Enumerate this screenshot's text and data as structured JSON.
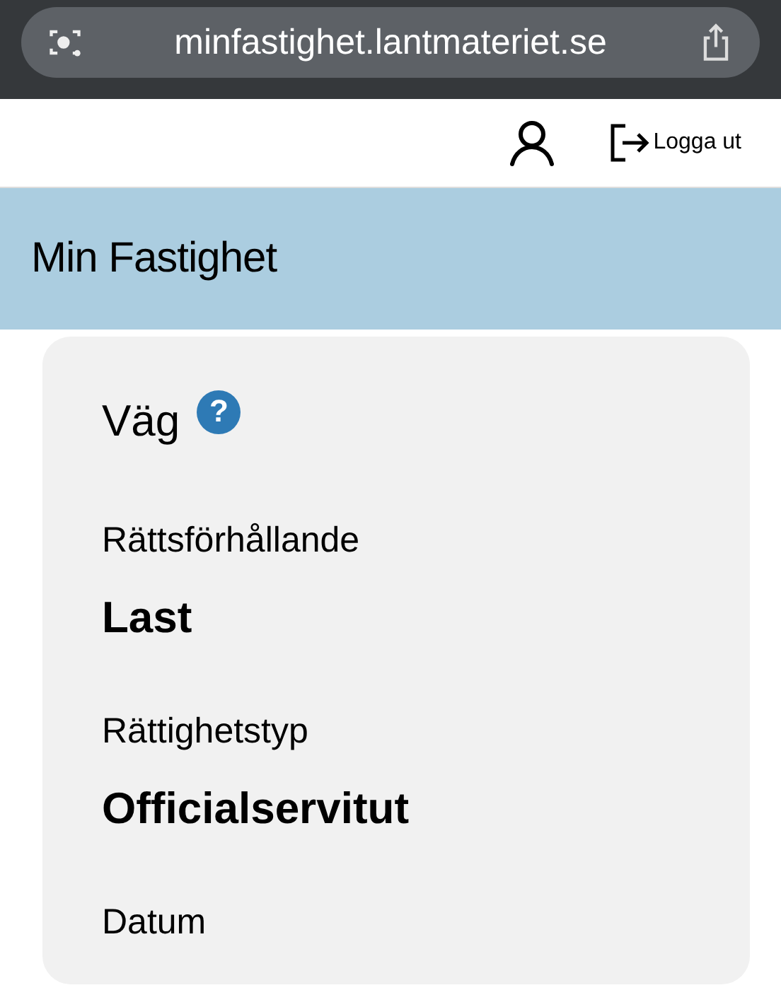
{
  "browser": {
    "url": "minfastighet.lantmateriet.se"
  },
  "header": {
    "logout": "Logga ut"
  },
  "banner": {
    "title": "Min Fastighet"
  },
  "card": {
    "title": "Väg",
    "help": "?",
    "fields": [
      {
        "label": "Rättsförhållande",
        "value": "Last"
      },
      {
        "label": "Rättighetstyp",
        "value": "Officialservitut"
      },
      {
        "label": "Datum"
      }
    ]
  }
}
